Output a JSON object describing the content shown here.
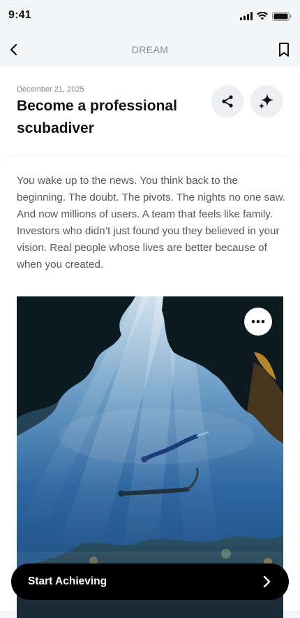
{
  "status": {
    "time": "9:41"
  },
  "nav": {
    "title": "DREAM",
    "back_icon": "chevron-left-icon",
    "bookmark_icon": "bookmark-icon"
  },
  "header": {
    "date": "December 21, 2025",
    "title": "Become a professional scubadiver",
    "share_icon": "share-icon",
    "ai_icon": "sparkle-icon"
  },
  "story": {
    "text": "You wake up to the news. You think back to the beginning. The doubt. The pivots. The nights no one saw. And now millions of users. A team that feels like family. Investors who didn’t just found you they believed in your vision. Real people whose lives are better because of when you created.",
    "image_subject": "free divers swimming through an underwater cave with sun rays",
    "more_icon": "more-horizontal-icon"
  },
  "cta": {
    "label": "Start Achieving",
    "arrow_icon": "chevron-right-icon"
  },
  "colors": {
    "accent": "#000000",
    "background": "#f4f5f7",
    "card": "#ffffff",
    "muted_text": "#55585e"
  }
}
